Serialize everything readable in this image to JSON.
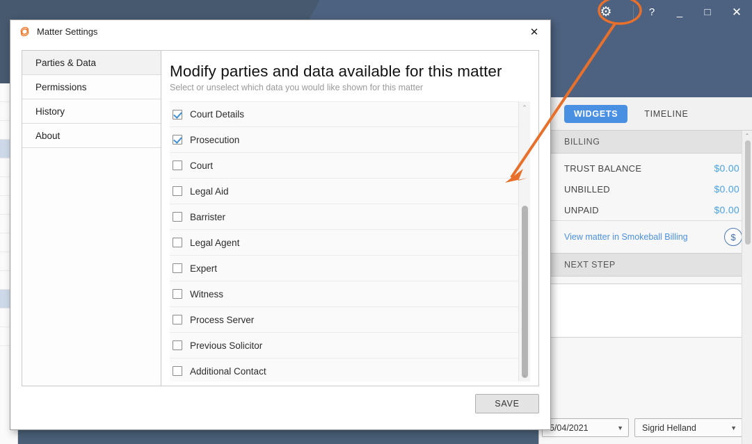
{
  "colors": {
    "app_chrome": "#4a5f78",
    "accent_blue": "#4a90e2",
    "value_blue": "#4aa3e8",
    "annotation_orange": "#e8702a",
    "checkmark_blue": "#3d8fd6"
  },
  "window_controls": {
    "settings_gear": "gear-icon",
    "help": "?",
    "minimize": "_",
    "maximize": "□",
    "close": "✕"
  },
  "dialog": {
    "title": "Matter Settings",
    "logo": "smokeball-logo-icon",
    "close_label": "✕",
    "nav": {
      "items": [
        {
          "label": "Parties & Data",
          "active": true
        },
        {
          "label": "Permissions",
          "active": false
        },
        {
          "label": "History",
          "active": false
        },
        {
          "label": "About",
          "active": false
        }
      ]
    },
    "heading": "Modify parties and data available for this matter",
    "subheading": "Select or unselect which data you would like shown for this matter",
    "list": [
      {
        "label": "Court Details",
        "checked": true
      },
      {
        "label": "Prosecution",
        "checked": true
      },
      {
        "label": "Court",
        "checked": false
      },
      {
        "label": "Legal Aid",
        "checked": false
      },
      {
        "label": "Barrister",
        "checked": false
      },
      {
        "label": "Legal Agent",
        "checked": false
      },
      {
        "label": "Expert",
        "checked": false
      },
      {
        "label": "Witness",
        "checked": false
      },
      {
        "label": "Process Server",
        "checked": false
      },
      {
        "label": "Previous Solicitor",
        "checked": false
      },
      {
        "label": "Additional Contact",
        "checked": false
      }
    ],
    "scroll_up": "⌃",
    "scroll_down": "⌄",
    "save_label": "SAVE"
  },
  "right_panel": {
    "tabs": [
      {
        "label": "WIDGETS",
        "active": true
      },
      {
        "label": "TIMELINE",
        "active": false
      }
    ],
    "billing": {
      "section_title": "BILLING",
      "rows": [
        {
          "label": "TRUST BALANCE",
          "value": "$0.00"
        },
        {
          "label": "UNBILLED",
          "value": "$0.00"
        },
        {
          "label": "UNPAID",
          "value": "$0.00"
        }
      ],
      "link": "View matter in Smokeball Billing",
      "badge": "$"
    },
    "next_step": {
      "section_title": "NEXT STEP",
      "note_value": ""
    },
    "controls": {
      "date": "5/04/2021",
      "user": "Sigrid Helland",
      "caret": "▼"
    },
    "scroll_up": "⌃"
  }
}
